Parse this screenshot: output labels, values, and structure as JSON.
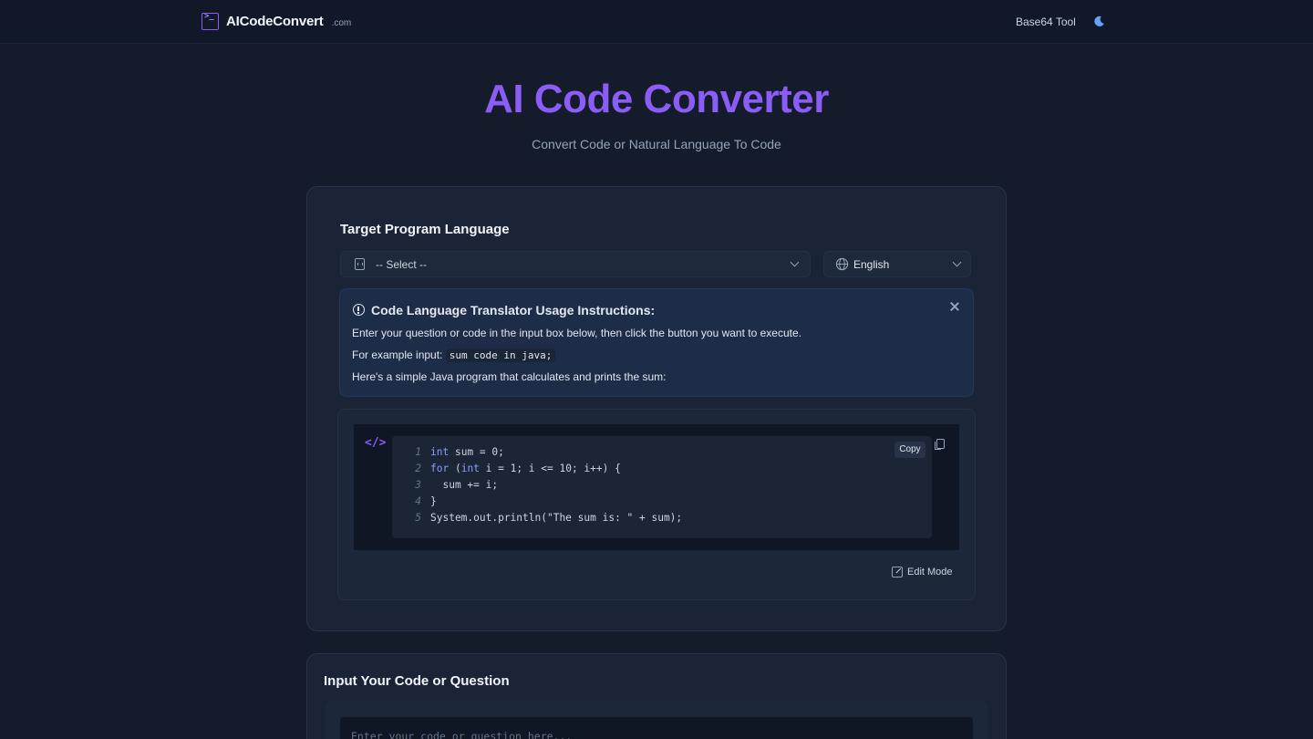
{
  "header": {
    "brand": "AICodeConvert",
    "brand_tld": ".com",
    "logo_glyph": ">_",
    "nav_link": "Base64 Tool",
    "theme_icon": "moon-icon"
  },
  "hero": {
    "title": "AI Code Converter",
    "subtitle": "Convert Code or Natural Language To Code"
  },
  "converter": {
    "section_title": "Target Program Language",
    "language_select": {
      "value": "-- Select --",
      "icon": "file-code-icon"
    },
    "locale_select": {
      "value": "English",
      "icon": "globe-icon"
    }
  },
  "instructions": {
    "title": "Code Language Translator Usage Instructions:",
    "line1": "Enter your question or code in the input box below, then click the button you want to execute.",
    "line2_prefix": "For example input:",
    "line2_code": "sum code in java;",
    "line3": "Here's a simple Java program that calculates and prints the sum:"
  },
  "code_example": {
    "tag_icon": "</>",
    "copy_label": "Copy",
    "edit_mode_label": "Edit Mode",
    "lines": [
      {
        "n": "1",
        "text": "int sum = 0;"
      },
      {
        "n": "2",
        "text": "for (int i = 1; i <= 10; i++) {"
      },
      {
        "n": "3",
        "text": "  sum += i;"
      },
      {
        "n": "4",
        "text": "}"
      },
      {
        "n": "5",
        "text": "System.out.println(\"The sum is: \" + sum);"
      }
    ]
  },
  "input_section": {
    "title": "Input Your Code or Question",
    "placeholder": "Enter your code or question here..."
  },
  "colors": {
    "accent": "#8b5cf6",
    "background": "#141c2b",
    "card": "#1a2436",
    "code_bg": "#0f1624"
  }
}
